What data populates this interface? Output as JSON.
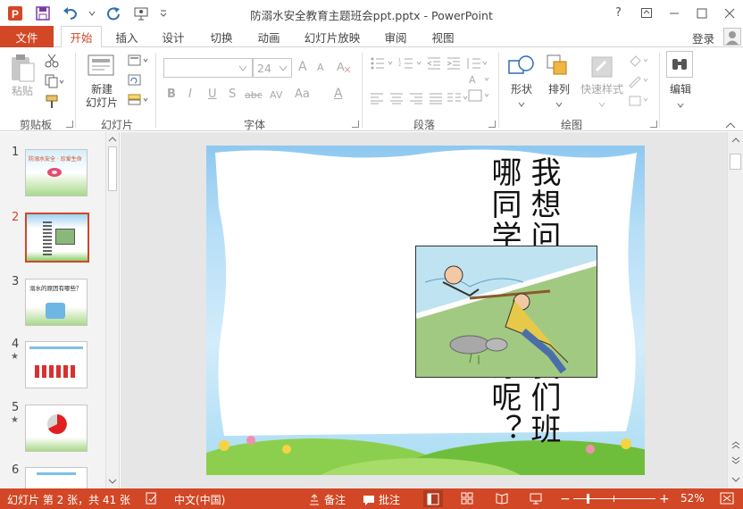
{
  "window": {
    "title": "防溺水安全教育主题班会ppt.pptx - PowerPoint",
    "help": "?",
    "login": "登录"
  },
  "tabs": {
    "file": "文件",
    "items": [
      "开始",
      "插入",
      "设计",
      "切换",
      "动画",
      "幻灯片放映",
      "审阅",
      "视图"
    ],
    "active": "开始"
  },
  "ribbon": {
    "clipboard": {
      "label": "剪贴板",
      "paste": "粘贴"
    },
    "slides": {
      "label": "幻灯片",
      "new_slide_line1": "新建",
      "new_slide_line2": "幻灯片"
    },
    "font": {
      "label": "字体",
      "size": "24",
      "bold": "B",
      "italic": "I",
      "underline": "U",
      "shadow": "S",
      "strike": "abc",
      "spacing": "AV",
      "case": "Aa",
      "color": "A",
      "grow": "A",
      "shrink": "A"
    },
    "paragraph": {
      "label": "段落"
    },
    "drawing": {
      "label": "绘图",
      "shape": "形状",
      "arrange": "排列",
      "quick_style": "快速样式"
    },
    "editing": {
      "label": "编辑"
    }
  },
  "thumbnails": [
    {
      "num": "1",
      "star": false,
      "text": "防溺水安全 · 珍爱生命"
    },
    {
      "num": "2",
      "star": false,
      "text": "",
      "active": true
    },
    {
      "num": "3",
      "star": false,
      "text": "溺水的原因有哪些？"
    },
    {
      "num": "4",
      "star": true,
      "text": ""
    },
    {
      "num": "5",
      "star": true,
      "text": ""
    },
    {
      "num": "6",
      "star": false,
      "text": ""
    }
  ],
  "slide": {
    "text": "我想问一问，我们班哪同学喜欢游泳呢？"
  },
  "status": {
    "slide_info": "幻灯片 第 2 张，共 41 张",
    "language": "中文(中国)",
    "notes": "备注",
    "comments": "批注",
    "zoom": "52%"
  },
  "colors": {
    "accent": "#d24726",
    "ribbon_bg": "#ffffff",
    "pane_bg": "#f3f3f3",
    "editor_bg": "#e6e6e6"
  }
}
